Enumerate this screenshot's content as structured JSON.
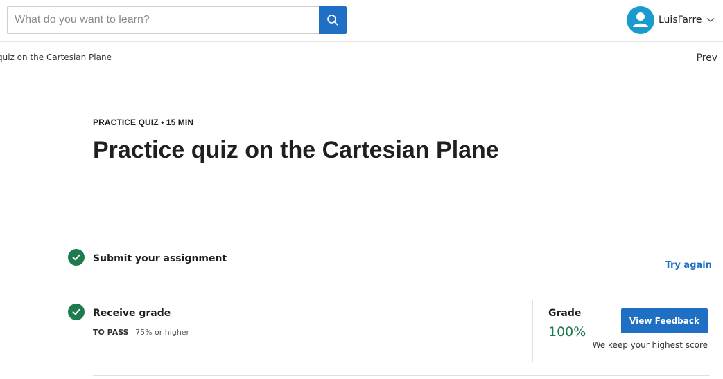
{
  "header": {
    "search": {
      "placeholder": "What do you want to learn?",
      "value": ""
    },
    "search_button_icon": "search-icon",
    "user": {
      "name": "LuisFarre",
      "avatar_icon": "user-avatar-icon",
      "menu_icon": "chevron-down-icon"
    }
  },
  "breadcrumb": {
    "text": "quiz on the Cartesian Plane",
    "prev_label": "Prev"
  },
  "quiz": {
    "eyebrow": "PRACTICE QUIZ • 15 MIN",
    "title": "Practice quiz on the Cartesian Plane"
  },
  "steps": {
    "submit": {
      "label": "Submit your assignment",
      "action": "Try again",
      "status_icon": "check-circle-icon"
    },
    "grade": {
      "label": "Receive grade",
      "status_icon": "check-circle-icon",
      "to_pass_label": "TO PASS",
      "to_pass_value": "75% or higher",
      "grade_label": "Grade",
      "grade_value": "100%",
      "feedback_button": "View Feedback",
      "note": "We keep your highest score"
    }
  },
  "colors": {
    "accent": "#1f6fc4",
    "success": "#1e7a4f",
    "avatar": "#1a9bd0"
  }
}
